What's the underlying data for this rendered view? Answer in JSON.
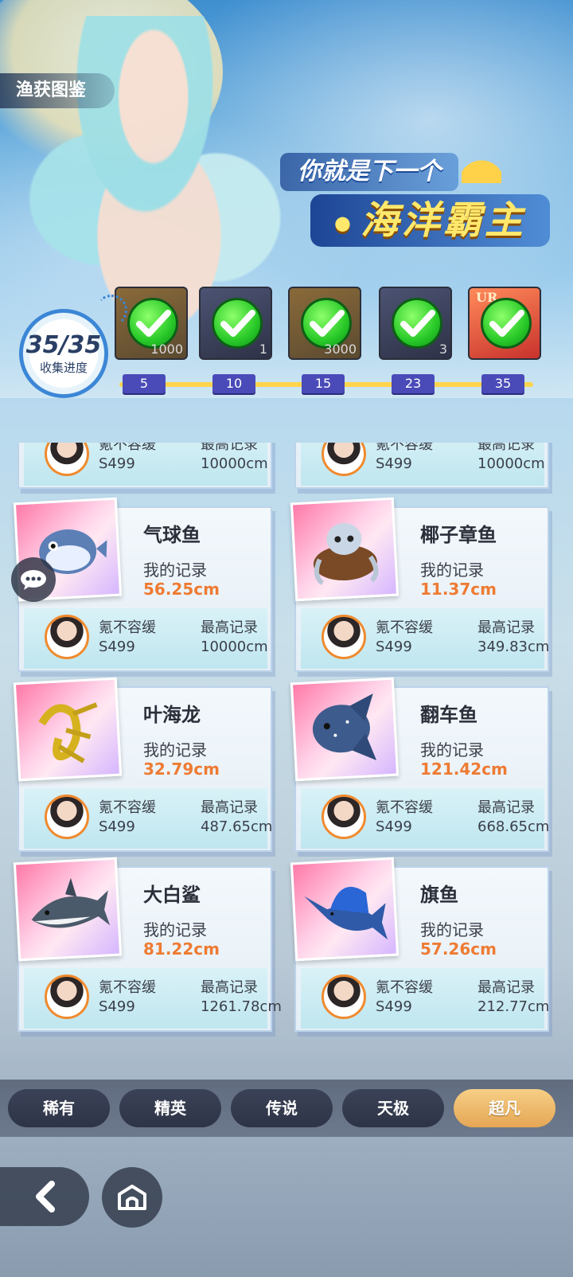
{
  "header": {
    "title": "渔获图鉴"
  },
  "slogan": {
    "line1": "你就是下一个",
    "line2": "海洋霸主"
  },
  "progress": {
    "value": "35/35",
    "label": "收集进度",
    "collected": 35,
    "total": 35
  },
  "rewards": [
    {
      "qty": "1000",
      "claimed": true,
      "milestone": "5"
    },
    {
      "qty": "1",
      "claimed": true,
      "milestone": "10"
    },
    {
      "qty": "3000",
      "claimed": true,
      "milestone": "15"
    },
    {
      "qty": "3",
      "claimed": true,
      "milestone": "23"
    },
    {
      "qty": "",
      "badge": "UR",
      "claimed": true,
      "milestone": "35"
    }
  ],
  "cards": [
    {
      "name": "",
      "my_label": "",
      "my_value": "",
      "player": "氪不容缓",
      "score": "S499",
      "best_label": "最高记录",
      "best_value": "10000cm"
    },
    {
      "name": "",
      "my_label": "",
      "my_value": "",
      "player": "氪不容缓",
      "score": "S499",
      "best_label": "最高记录",
      "best_value": "10000cm"
    },
    {
      "name": "气球鱼",
      "my_label": "我的记录",
      "my_value": "56.25cm",
      "player": "氪不容缓",
      "score": "S499",
      "best_label": "最高记录",
      "best_value": "10000cm"
    },
    {
      "name": "椰子章鱼",
      "my_label": "我的记录",
      "my_value": "11.37cm",
      "player": "氪不容缓",
      "score": "S499",
      "best_label": "最高记录",
      "best_value": "349.83cm"
    },
    {
      "name": "叶海龙",
      "my_label": "我的记录",
      "my_value": "32.79cm",
      "player": "氪不容缓",
      "score": "S499",
      "best_label": "最高记录",
      "best_value": "487.65cm"
    },
    {
      "name": "翻车鱼",
      "my_label": "我的记录",
      "my_value": "121.42cm",
      "player": "氪不容缓",
      "score": "S499",
      "best_label": "最高记录",
      "best_value": "668.65cm"
    },
    {
      "name": "大白鲨",
      "my_label": "我的记录",
      "my_value": "81.22cm",
      "player": "氪不容缓",
      "score": "S499",
      "best_label": "最高记录",
      "best_value": "1261.78cm"
    },
    {
      "name": "旗鱼",
      "my_label": "我的记录",
      "my_value": "57.26cm",
      "player": "氪不容缓",
      "score": "S499",
      "best_label": "最高记录",
      "best_value": "212.77cm"
    }
  ],
  "tabs": [
    {
      "label": "稀有",
      "active": false
    },
    {
      "label": "精英",
      "active": false
    },
    {
      "label": "传说",
      "active": false
    },
    {
      "label": "天极",
      "active": false
    },
    {
      "label": "超凡",
      "active": true
    }
  ],
  "nav": {
    "back_icon": "chevron-left-icon",
    "home_icon": "home-icon",
    "chat_icon": "chat-bubble-icon"
  },
  "colors": {
    "accent": "#e5a654",
    "record_value": "#ee7b33",
    "milestone": "#4a4bb8",
    "check": "#28c928"
  }
}
